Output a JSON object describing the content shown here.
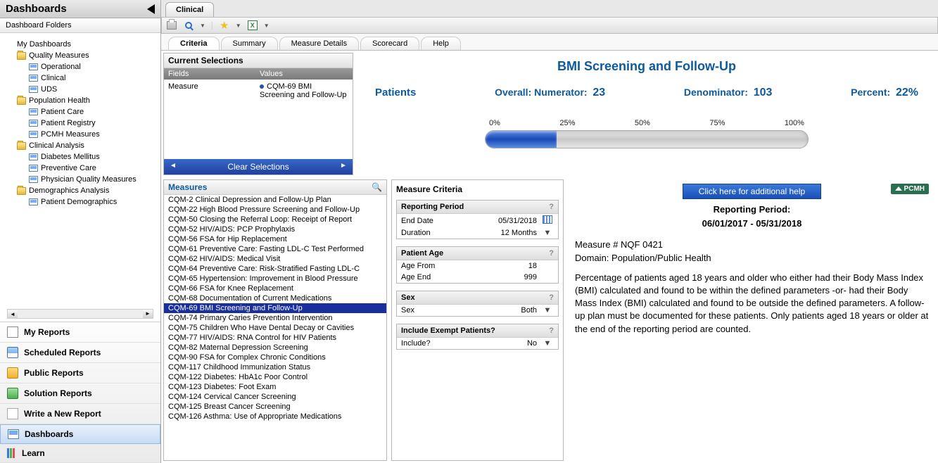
{
  "sidebar": {
    "title": "Dashboards",
    "subheader": "Dashboard Folders",
    "tree": [
      {
        "type": "text",
        "label": "My Dashboards",
        "level": 1
      },
      {
        "type": "folder",
        "label": "Quality Measures",
        "level": 1
      },
      {
        "type": "dash",
        "label": "Operational",
        "level": 2
      },
      {
        "type": "dash",
        "label": "Clinical",
        "level": 2
      },
      {
        "type": "dash",
        "label": "UDS",
        "level": 2
      },
      {
        "type": "folder",
        "label": "Population Health",
        "level": 1
      },
      {
        "type": "dash",
        "label": "Patient Care",
        "level": 2
      },
      {
        "type": "dash",
        "label": "Patient Registry",
        "level": 2
      },
      {
        "type": "dash",
        "label": "PCMH Measures",
        "level": 2
      },
      {
        "type": "folder",
        "label": "Clinical Analysis",
        "level": 1
      },
      {
        "type": "dash",
        "label": "Diabetes Mellitus",
        "level": 2
      },
      {
        "type": "dash",
        "label": "Preventive Care",
        "level": 2
      },
      {
        "type": "dash",
        "label": "Physician Quality Measures",
        "level": 2
      },
      {
        "type": "folder",
        "label": "Demographics Analysis",
        "level": 1
      },
      {
        "type": "dash",
        "label": "Patient Demographics",
        "level": 2
      }
    ],
    "nav": [
      {
        "label": "My Reports",
        "icon": "page"
      },
      {
        "label": "Scheduled Reports",
        "icon": "cal"
      },
      {
        "label": "Public Reports",
        "icon": "pub"
      },
      {
        "label": "Solution Reports",
        "icon": "sol"
      },
      {
        "label": "Write a New Report",
        "icon": "blank"
      },
      {
        "label": "Dashboards",
        "icon": "dash",
        "active": true
      },
      {
        "label": "Learn",
        "icon": "learn"
      }
    ]
  },
  "topTab": "Clinical",
  "subTabs": [
    "Criteria",
    "Summary",
    "Measure Details",
    "Scorecard",
    "Help"
  ],
  "activeSubTab": "Criteria",
  "selections": {
    "title": "Current Selections",
    "fieldsHeader": "Fields",
    "valuesHeader": "Values",
    "field": "Measure",
    "value": "CQM-69  BMI Screening and Follow-Up",
    "clear": "Clear Selections"
  },
  "chart_data": {
    "type": "bar",
    "title": "BMI Screening and Follow-Up",
    "patientsLabel": "Patients",
    "overallLabel": "Overall:",
    "numeratorLabel": "Numerator:",
    "numerator": 23,
    "denominatorLabel": "Denominator:",
    "denominator": 103,
    "percentLabel": "Percent:",
    "percent": 22,
    "ticks": [
      "0%",
      "25%",
      "50%",
      "75%",
      "100%"
    ],
    "fillWidth": "22%"
  },
  "measures": {
    "title": "Measures",
    "items": [
      "CQM-2  Clinical Depression and Follow-Up Plan",
      "CQM-22  High Blood Pressure Screening and Follow-Up",
      "CQM-50  Closing the Referral Loop: Receipt of Report",
      "CQM-52  HIV/AIDS: PCP Prophylaxis",
      "CQM-56  FSA for Hip Replacement",
      "CQM-61  Preventive Care: Fasting LDL-C Test Performed",
      "CQM-62  HIV/AIDS: Medical Visit",
      "CQM-64  Preventive Care: Risk-Stratified Fasting LDL-C",
      "CQM-65  Hypertension: Improvement in Blood Pressure",
      "CQM-66  FSA for Knee Replacement",
      "CQM-68  Documentation of Current Medications",
      "CQM-69  BMI Screening and Follow-Up",
      "CQM-74  Primary Caries Prevention Intervention",
      "CQM-75  Children Who Have Dental Decay or Cavities",
      "CQM-77  HIV/AIDS: RNA Control for HIV Patients",
      "CQM-82  Maternal Depression Screening",
      "CQM-90  FSA for Complex Chronic Conditions",
      "CQM-117  Childhood Immunization Status",
      "CQM-122  Diabetes: HbA1c Poor Control",
      "CQM-123  Diabetes: Foot Exam",
      "CQM-124  Cervical Cancer Screening",
      "CQM-125  Breast Cancer Screening",
      "CQM-126  Asthma: Use of Appropriate Medications"
    ],
    "selectedIndex": 11
  },
  "criteria": {
    "title": "Measure Criteria",
    "groups": [
      {
        "title": "Reporting Period",
        "rows": [
          {
            "lbl": "End Date",
            "val": "05/31/2018",
            "ctrl": "cal"
          },
          {
            "lbl": "Duration",
            "val": "12 Months",
            "ctrl": "dd"
          }
        ]
      },
      {
        "title": "Patient Age",
        "rows": [
          {
            "lbl": "Age From",
            "val": "18"
          },
          {
            "lbl": "Age End",
            "val": "999"
          }
        ]
      },
      {
        "title": "Sex",
        "rows": [
          {
            "lbl": "Sex",
            "val": "Both",
            "ctrl": "dd"
          }
        ]
      },
      {
        "title": "Include Exempt Patients?",
        "rows": [
          {
            "lbl": "Include?",
            "val": "No",
            "ctrl": "dd"
          }
        ]
      }
    ]
  },
  "details": {
    "helpBtn": "Click here for additional help",
    "pcmh": "PCMH",
    "periodLabel": "Reporting Period:",
    "period": "06/01/2017 - 05/31/2018",
    "measureNum": "Measure # NQF 0421",
    "domain": "Domain:  Population/Public Health",
    "desc": "Percentage of patients aged 18 years and older who either had their Body Mass Index (BMI) calculated and found to be within the defined parameters -or- had their Body Mass Index (BMI) calculated and found to be outside the defined parameters. A follow-up plan must be documented for these patients. Only patients aged 18 years or older at the end of the reporting period are counted."
  }
}
